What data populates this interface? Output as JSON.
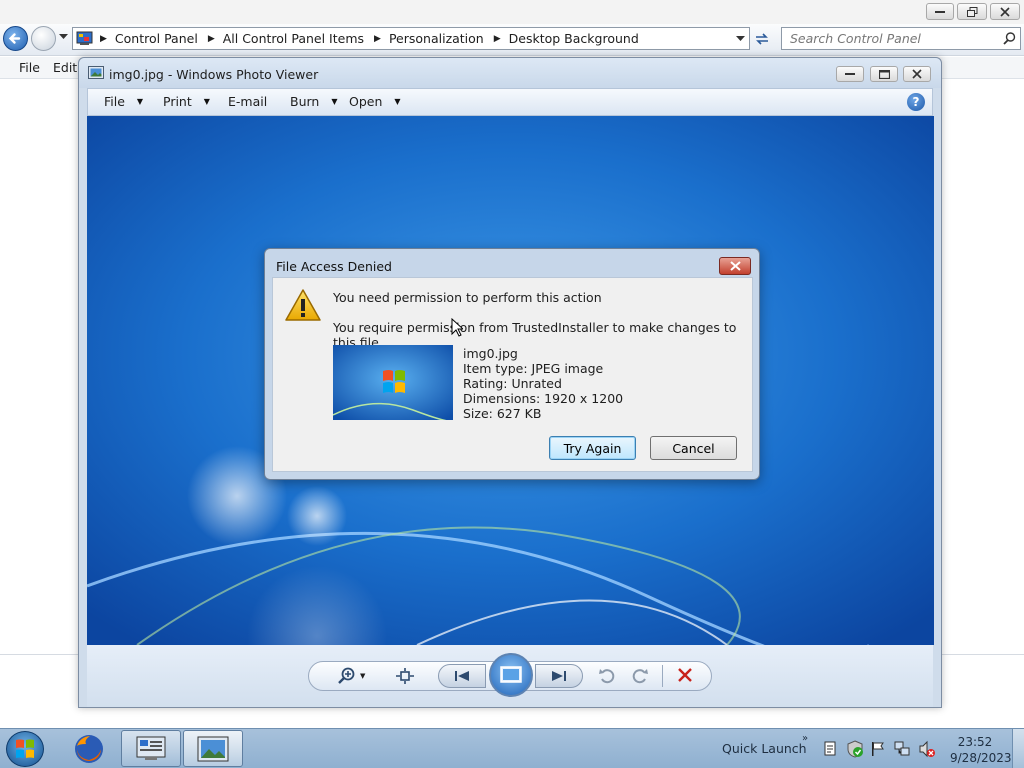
{
  "explorer": {
    "breadcrumbs": [
      "Control Panel",
      "All Control Panel Items",
      "Personalization",
      "Desktop Background"
    ],
    "search_placeholder": "Search Control Panel",
    "menu": [
      "File",
      "Edit"
    ]
  },
  "photo_viewer": {
    "title": "img0.jpg - Windows Photo Viewer",
    "commands": [
      {
        "label": "File",
        "has_dropdown": true
      },
      {
        "label": "Print",
        "has_dropdown": true
      },
      {
        "label": "E-mail",
        "has_dropdown": false
      },
      {
        "label": "Burn",
        "has_dropdown": true
      },
      {
        "label": "Open",
        "has_dropdown": true
      }
    ],
    "controls": [
      "zoom-icon",
      "actual-size-icon",
      "previous-icon",
      "slideshow-icon",
      "next-icon",
      "rotate-ccw-icon",
      "rotate-cw-icon",
      "delete-icon"
    ]
  },
  "dialog": {
    "title": "File Access Denied",
    "heading": "You need permission to perform this action",
    "message": "You require permission from TrustedInstaller to make changes to this file",
    "file": {
      "name": "img0.jpg",
      "type": "Item type: JPEG image",
      "rating": "Rating: Unrated",
      "dimensions": "Dimensions: 1920 x 1200",
      "size": "Size: 627 KB"
    },
    "try_again": "Try Again",
    "cancel": "Cancel"
  },
  "taskbar": {
    "quick_launch": "Quick Launch",
    "time": "23:52",
    "date": "9/28/2023"
  },
  "colors": {
    "accent": "#1f63b8",
    "close_red": "#c2402e",
    "wallpaper": "#1d6bc8"
  }
}
